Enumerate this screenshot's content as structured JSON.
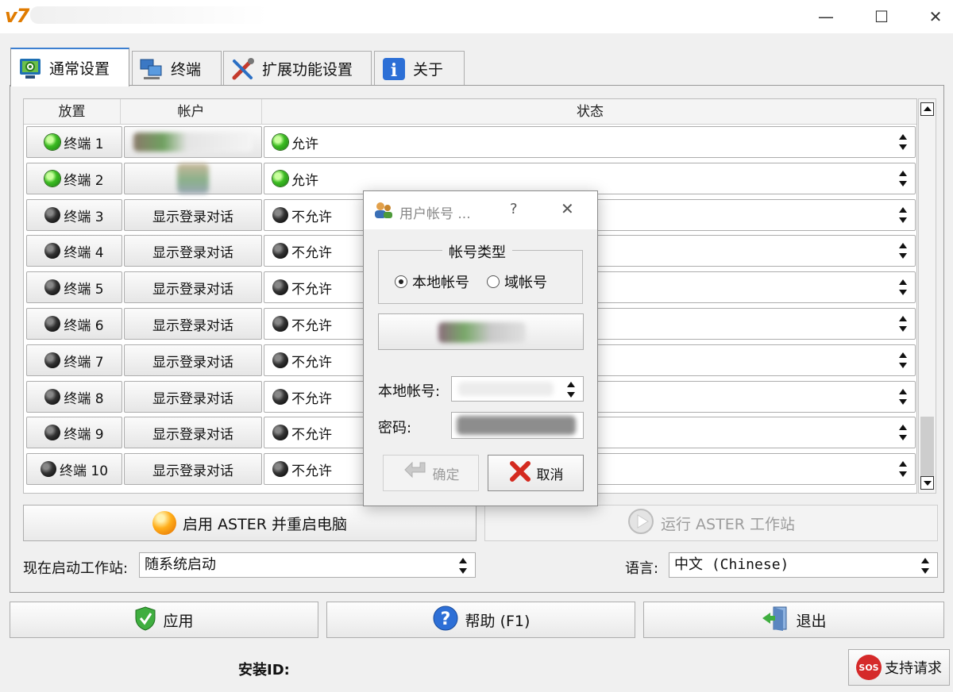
{
  "window": {
    "logo_text": "v7",
    "minimize": "—",
    "maximize": "☐",
    "close": "✕"
  },
  "tabs": [
    {
      "label": "通常设置",
      "icon": "settings-monitor-icon"
    },
    {
      "label": "终端",
      "icon": "terminals-icon"
    },
    {
      "label": "扩展功能设置",
      "icon": "tools-icon"
    },
    {
      "label": "关于",
      "icon": "info-icon"
    }
  ],
  "table": {
    "headers": {
      "seat": "放置",
      "account": "帐户",
      "status": "状态"
    },
    "rows": [
      {
        "terminal": "终端 1",
        "account": "",
        "status": "允许",
        "led": "green"
      },
      {
        "terminal": "终端 2",
        "account": "",
        "status": "允许",
        "led": "green"
      },
      {
        "terminal": "终端 3",
        "account": "显示登录对话",
        "status": "不允许",
        "led": "black"
      },
      {
        "terminal": "终端 4",
        "account": "显示登录对话",
        "status": "不允许",
        "led": "black"
      },
      {
        "terminal": "终端 5",
        "account": "显示登录对话",
        "status": "不允许",
        "led": "black"
      },
      {
        "terminal": "终端 6",
        "account": "显示登录对话",
        "status": "不允许",
        "led": "black"
      },
      {
        "terminal": "终端 7",
        "account": "显示登录对话",
        "status": "不允许",
        "led": "black"
      },
      {
        "terminal": "终端 8",
        "account": "显示登录对话",
        "status": "不允许",
        "led": "black"
      },
      {
        "terminal": "终端 9",
        "account": "显示登录对话",
        "status": "不允许",
        "led": "black"
      },
      {
        "terminal": "终端 10",
        "account": "显示登录对话",
        "status": "不允许",
        "led": "black"
      }
    ]
  },
  "actions": {
    "enable_label": "启用 ASTER 并重启电脑",
    "run_label": "运行 ASTER 工作站"
  },
  "startup": {
    "label": "现在启动工作站:",
    "value": "随系统启动"
  },
  "language": {
    "label": "语言:",
    "value": "中文 (Chinese)"
  },
  "footer": {
    "apply": "应用",
    "help": "帮助 (F1)",
    "exit": "退出",
    "install_id_label": "安装ID:",
    "support": "支持请求",
    "sos": "SOS"
  },
  "dialog": {
    "title": "用户帐号 ...",
    "help_glyph": "?",
    "close_glyph": "✕",
    "group_title": "帐号类型",
    "radio_local": "本地帐号",
    "radio_domain": "域帐号",
    "local_account_label": "本地帐号:",
    "password_label": "密码:",
    "ok": "确定",
    "cancel": "取消"
  },
  "colors": {
    "accent_tab_border": "#3c7fd0",
    "green_led": "#3cbc22",
    "black_led": "#222222"
  }
}
